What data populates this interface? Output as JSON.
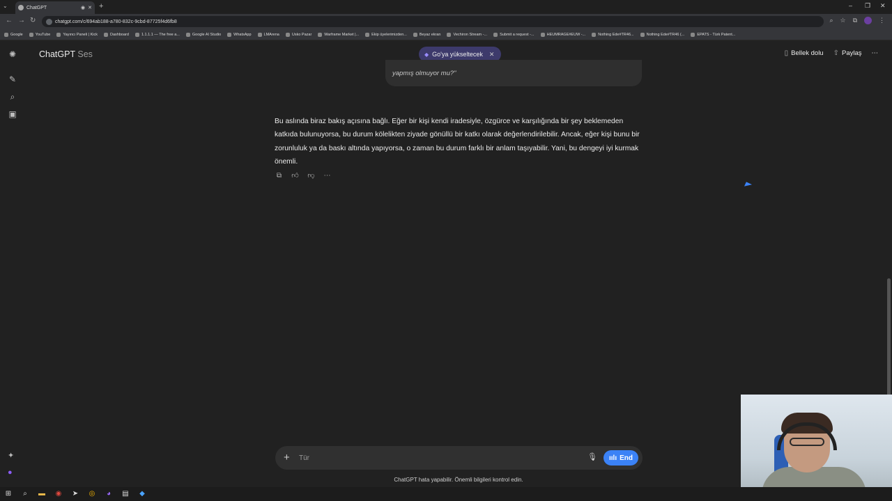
{
  "browser": {
    "tab_title": "ChatGPT",
    "new_tab_symbol": "+",
    "url": "chatgpt.com/c/694ab188-a780-832c-9cbd-87725f4d6fb8",
    "bookmarks": [
      "Google",
      "YouTube",
      "Yayıncı Paneli | Kick",
      "Dashboard",
      "1.1.1.1 — The free a...",
      "Google AI Studio",
      "WhatsApp",
      "LMArena",
      "Usko Pazar",
      "Warframe Market |...",
      "Ekip üyelerimizden...",
      "Beyaz ekran",
      "Vechiron Stream -...",
      "Submit a request -...",
      "HEUMRAGE#EUW -...",
      "Nothing Ede#TR46...",
      "Nothing Ede#TR46 (...",
      "EPATS - Türk Patent..."
    ]
  },
  "header": {
    "app_name": "ChatGPT",
    "mode": "Ses",
    "upgrade_label": "Go'ya yükseltecek",
    "memory_label": "Bellek dolu",
    "share_label": "Paylaş"
  },
  "conversation": {
    "user_message_tail": "yapmış olmuyor mu?\"",
    "assistant_message": "Bu aslında biraz bakış açısına bağlı. Eğer bir kişi kendi iradesiyle, özgürce ve karşılığında bir şey beklemeden katkıda bulunuyorsa, bu durum kölelikten ziyade gönüllü bir katkı olarak değerlendirilebilir. Ancak, eğer kişi bunu bir zorunluluk ya da baskı altında yapıyorsa, o zaman bu durum farklı bir anlam taşıyabilir. Yani, bu dengeyi iyi kurmak önemli."
  },
  "composer": {
    "placeholder": "Tür",
    "end_label": "End"
  },
  "footer": {
    "disclaimer": "ChatGPT hata yapabilir. Önemli bilgileri kontrol edin."
  },
  "colors": {
    "background": "#212121",
    "accent_blue": "#3b82f6",
    "upgrade_pill": "#3d3a6b"
  },
  "icons": {
    "rail": [
      "openai-logo-icon",
      "new-chat-icon",
      "search-icon",
      "library-icon"
    ],
    "actions": [
      "copy-icon",
      "thumbs-up-icon",
      "thumbs-down-icon",
      "more-icon"
    ]
  }
}
